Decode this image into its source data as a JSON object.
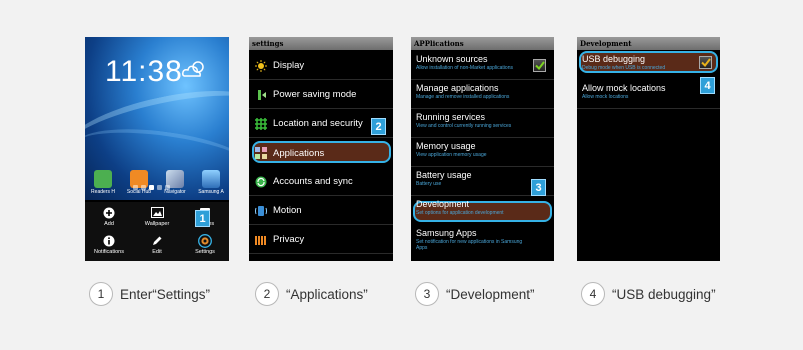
{
  "steps": [
    {
      "number": "1",
      "caption": "Enter“Settings”"
    },
    {
      "number": "2",
      "caption": "“Applications”"
    },
    {
      "number": "3",
      "caption": "“Development”"
    },
    {
      "number": "4",
      "caption": "“USB debugging”"
    }
  ],
  "home": {
    "clock": "11:38",
    "dock_apps": [
      "Readers H",
      "Social Hub",
      "Navigator",
      "Samsung A"
    ],
    "tray": [
      "Add",
      "Wallpaper",
      "Scenes",
      "Notifications",
      "Edit",
      "Settings"
    ],
    "badge": "1"
  },
  "settings": {
    "title": "settings",
    "items": [
      "Display",
      "Power saving mode",
      "Location and security",
      "Applications",
      "Accounts and sync",
      "Motion",
      "Privacy"
    ],
    "badge": "2"
  },
  "applications": {
    "title": "APPlications",
    "items": [
      {
        "title": "Unknown sources",
        "subtitle": "Allow installation of non-Market applications"
      },
      {
        "title": "Manage applications",
        "subtitle": "Manage and remove installed applications"
      },
      {
        "title": "Running services",
        "subtitle": "View and control currently running services"
      },
      {
        "title": "Memory usage",
        "subtitle": "View application memory usage"
      },
      {
        "title": "Battery usage",
        "subtitle": "Battery use"
      },
      {
        "title": "Development",
        "subtitle": "Set options for application development"
      },
      {
        "title": "Samsung Apps",
        "subtitle": "Set notification for new applications in Samsung Apps"
      }
    ],
    "badge": "3"
  },
  "development": {
    "title": "Development",
    "items": [
      {
        "title": "USB debugging",
        "subtitle": "Debug mode when USB is connected"
      },
      {
        "title": "Allow mock locations",
        "subtitle": "Allow mock locations"
      }
    ],
    "badge": "4"
  },
  "colors": {
    "highlight": "#36b2e6",
    "badge": "#2e9fd8",
    "selected_row": "#5a2a18"
  }
}
